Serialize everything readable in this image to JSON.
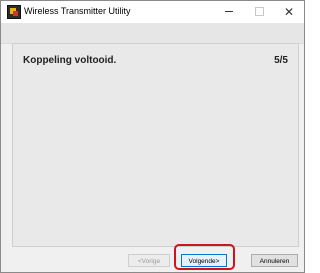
{
  "window": {
    "title": "Wireless Transmitter Utility",
    "icons": {
      "app": "app-icon",
      "minimize": "minimize-icon",
      "maximize": "maximize-icon",
      "close": "close-icon"
    },
    "close_glyph": "✕"
  },
  "content": {
    "heading": "Koppeling voltooid.",
    "step": "5/5"
  },
  "buttons": {
    "back": "<Vorige",
    "next": "Volgende>",
    "cancel": "Annuleren"
  },
  "colors": {
    "highlight": "#d0141e",
    "focus_border": "#0078d7"
  }
}
